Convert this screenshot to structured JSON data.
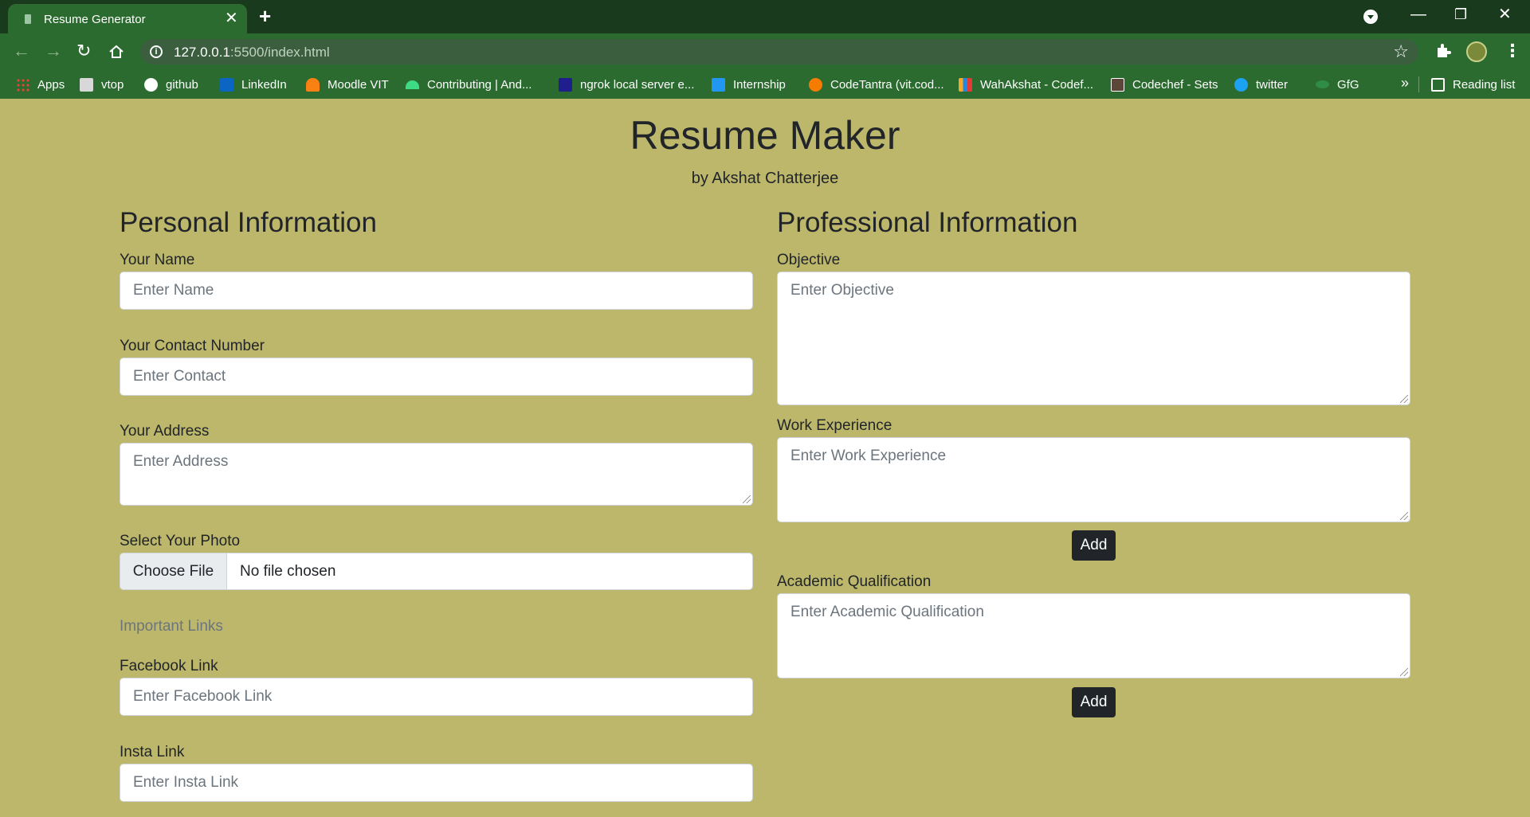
{
  "browser": {
    "tab_title": "Resume Generator",
    "tab_close": "✕",
    "new_tab": "+",
    "url_host": "127.0.0.1",
    "url_rest": ":5500/index.html",
    "bookmarks": [
      {
        "label": "Apps",
        "color": "#f4b400"
      },
      {
        "label": "vtop",
        "color": "#d8d8d8"
      },
      {
        "label": "github",
        "color": "#ffffff"
      },
      {
        "label": "LinkedIn",
        "color": "#0a66c2"
      },
      {
        "label": "Moodle VIT",
        "color": "#f98012"
      },
      {
        "label": "Contributing | And...",
        "color": "#3ddc84"
      },
      {
        "label": "ngrok local server e...",
        "color": "#1f1e8c"
      },
      {
        "label": "Internship",
        "color": "#2196f3"
      },
      {
        "label": "CodeTantra (vit.cod...",
        "color": "#f57c00"
      },
      {
        "label": "WahAkshat - Codef...",
        "color": "#f9a825"
      },
      {
        "label": "Codechef - Sets",
        "color": "#5b4638"
      },
      {
        "label": "twitter",
        "color": "#1da1f2"
      },
      {
        "label": "GfG",
        "color": "#2f8d46"
      }
    ],
    "more_bookmarks": "»",
    "reading_list": "Reading list"
  },
  "header": {
    "title": "Resume Maker",
    "byline": "by Akshat Chatterjee"
  },
  "personal": {
    "title": "Personal Information",
    "name_label": "Your Name",
    "name_placeholder": "Enter Name",
    "contact_label": "Your Contact Number",
    "contact_placeholder": "Enter Contact",
    "address_label": "Your Address",
    "address_placeholder": "Enter Address",
    "photo_label": "Select Your Photo",
    "photo_button": "Choose File",
    "photo_status": "No file chosen",
    "links_heading": "Important Links",
    "facebook_label": "Facebook Link",
    "facebook_placeholder": "Enter Facebook Link",
    "insta_label": "Insta Link",
    "insta_placeholder": "Enter Insta Link"
  },
  "professional": {
    "title": "Professional Information",
    "objective_label": "Objective",
    "objective_placeholder": "Enter Objective",
    "work_label": "Work Experience",
    "work_placeholder": "Enter Work Experience",
    "work_add": "Add",
    "academic_label": "Academic Qualification",
    "academic_placeholder": "Enter Academic Qualification",
    "academic_add": "Add"
  },
  "colors": {
    "page_bg": "#bdb76b",
    "chrome_dark": "#1a3a1d",
    "chrome": "#2b6b2f",
    "button_dark": "#212529"
  }
}
